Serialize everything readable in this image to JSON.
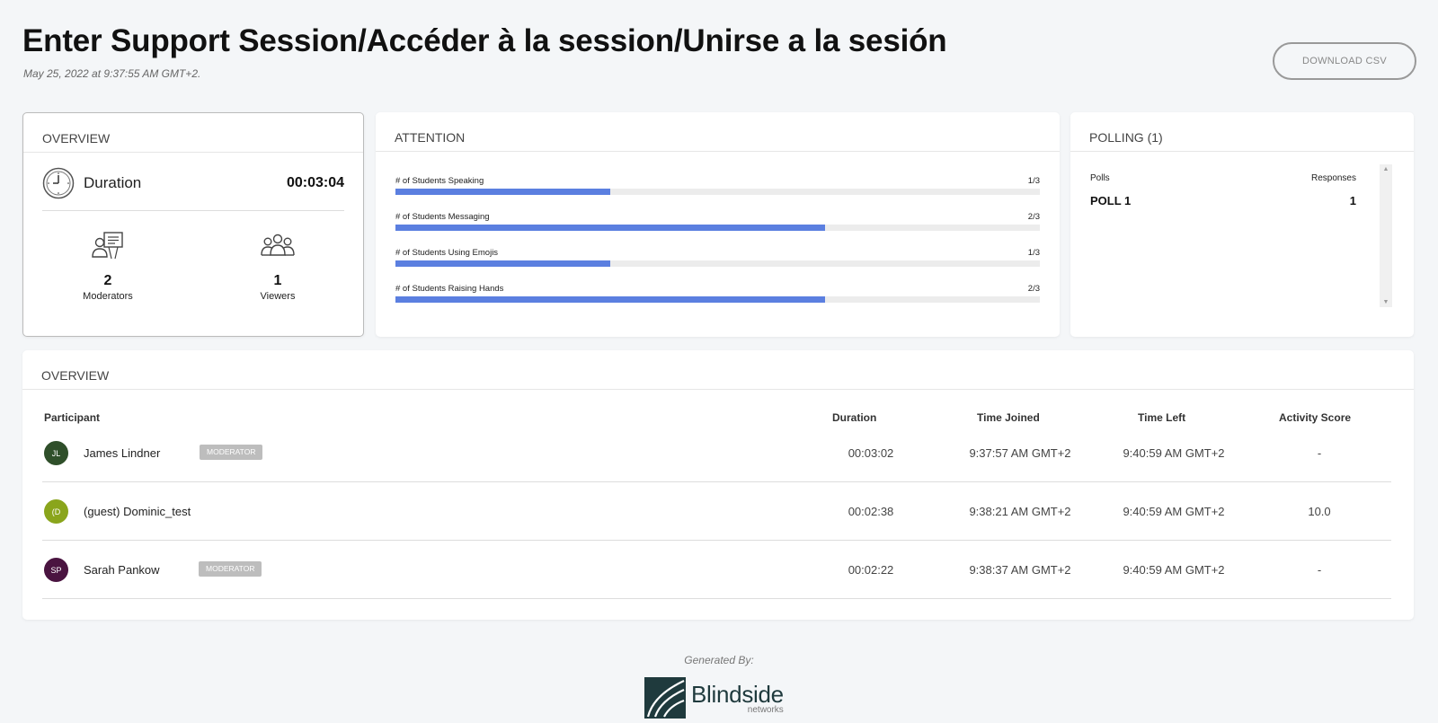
{
  "header": {
    "title": "Enter Support Session/Accéder à la session/Unirse a la sesión",
    "date": "May 25, 2022 at 9:37:55 AM GMT+2.",
    "download_label": "DOWNLOAD CSV"
  },
  "overview": {
    "title": "OVERVIEW",
    "duration_label": "Duration",
    "duration_value": "00:03:04",
    "moderators_count": "2",
    "moderators_label": "Moderators",
    "viewers_count": "1",
    "viewers_label": "Viewers"
  },
  "attention": {
    "title": "ATTENTION",
    "rows": [
      {
        "label": "# of Students Speaking",
        "value": "1/3",
        "fraction": 0.333
      },
      {
        "label": "# of Students Messaging",
        "value": "2/3",
        "fraction": 0.667
      },
      {
        "label": "# of Students Using Emojis",
        "value": "1/3",
        "fraction": 0.333
      },
      {
        "label": "# of Students Raising Hands",
        "value": "2/3",
        "fraction": 0.667
      }
    ],
    "bar_color": "#5b7fe0"
  },
  "polling": {
    "title": "POLLING (1)",
    "col_polls": "Polls",
    "col_responses": "Responses",
    "polls": [
      {
        "name": "POLL 1",
        "responses": "1"
      }
    ]
  },
  "participants": {
    "title": "OVERVIEW",
    "columns": {
      "participant": "Participant",
      "duration": "Duration",
      "joined": "Time Joined",
      "left": "Time Left",
      "score": "Activity Score"
    },
    "rows": [
      {
        "initials": "JL",
        "name": "James Lindner",
        "badge": "MODERATOR",
        "avatar_color": "#2f4f2a",
        "duration": "00:03:02",
        "joined": "9:37:57 AM GMT+2",
        "left": "9:40:59 AM GMT+2",
        "score": "-"
      },
      {
        "initials": "(D",
        "name": "(guest) Dominic_test",
        "badge": "",
        "avatar_color": "#8aa51c",
        "duration": "00:02:38",
        "joined": "9:38:21 AM GMT+2",
        "left": "9:40:59 AM GMT+2",
        "score": "10.0"
      },
      {
        "initials": "SP",
        "name": "Sarah Pankow",
        "badge": "MODERATOR",
        "avatar_color": "#4a1440",
        "duration": "00:02:22",
        "joined": "9:38:37 AM GMT+2",
        "left": "9:40:59 AM GMT+2",
        "score": "-"
      }
    ]
  },
  "footer": {
    "generated_by": "Generated By:",
    "logo_name": "Blindside",
    "logo_sub": "networks"
  },
  "icons": {
    "clock": "clock-icon",
    "moderators": "presenter-icon",
    "viewers": "group-icon",
    "logo": "blindside-logo"
  }
}
